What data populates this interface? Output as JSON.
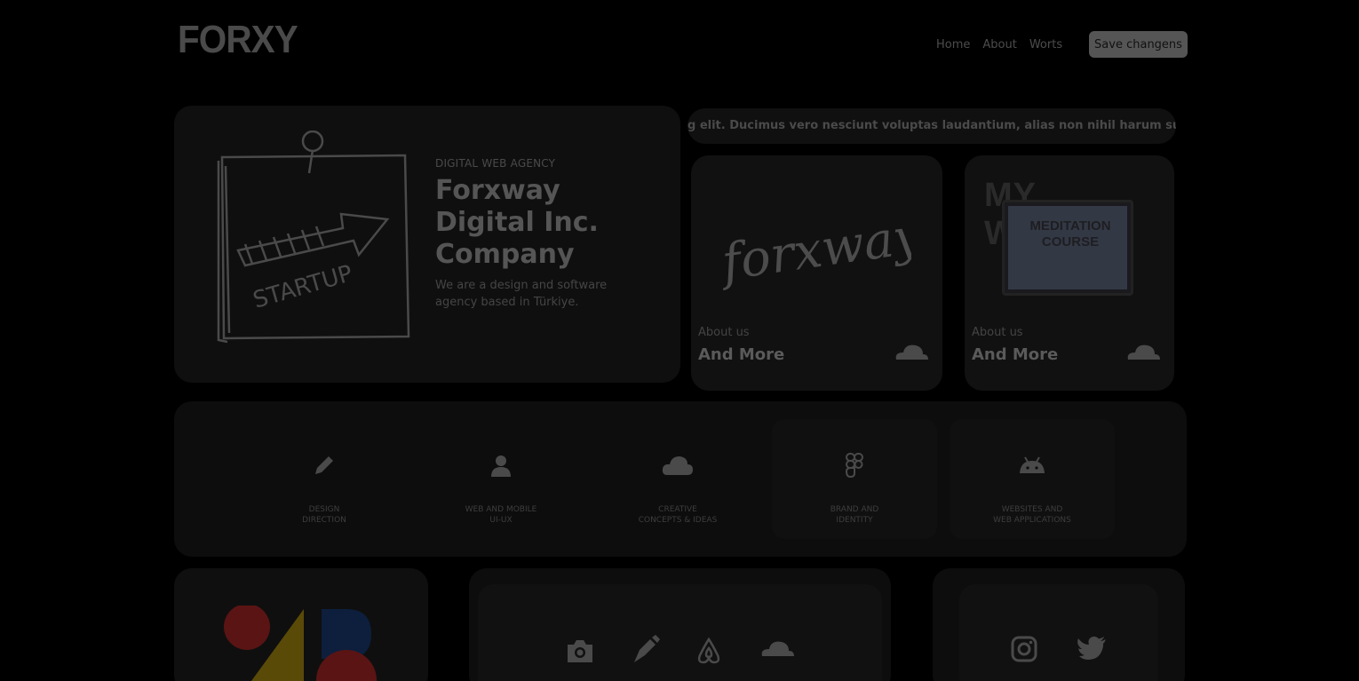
{
  "header": {
    "logo": "FORXY",
    "nav": [
      "Home",
      "About",
      "Worts"
    ],
    "save_button": "Save changens"
  },
  "hero": {
    "subtitle": "DIGITAL WEB AGENCY",
    "title": "Forxway Digital Inc. Company",
    "description": "We are a design and software agency based in Türkiye.",
    "sketch_text": "STARTUP"
  },
  "marquee": {
    "text": "g elit. Ducimus vero nesciunt voluptas laudantium, alias non nihil harum sunt voluptatum se"
  },
  "tiles": [
    {
      "signature": "forxway",
      "caption": "About us",
      "heading": "And More",
      "icon": "cloudflare-icon"
    },
    {
      "banner": "MY WORKS",
      "screen_text": "MEDITATION COURSE",
      "caption": "About us",
      "heading": "And More",
      "icon": "cloudflare-icon"
    }
  ],
  "services": [
    {
      "icon": "pencil-icon",
      "line1": "DESIGN",
      "line2": "DIRECTION"
    },
    {
      "icon": "user-icon",
      "line1": "WEB AND MOBILE",
      "line2": "UI-UX"
    },
    {
      "icon": "cloud-icon",
      "line1": "CREATIVE",
      "line2": "CONCEPTS & IDEAS"
    },
    {
      "icon": "figma-icon",
      "line1": "BRAND AND",
      "line2": "IDENTITY"
    },
    {
      "icon": "android-icon",
      "line1": "WEBSITES AND",
      "line2": "WEB APPLICATIONS"
    }
  ],
  "tools": [
    "camera-icon",
    "pen-icon",
    "airbnb-icon",
    "cloudflare-icon"
  ],
  "social": [
    "instagram-icon",
    "twitter-icon"
  ],
  "colors": {
    "background": "#000000",
    "card": "#0d0d0d",
    "text_muted": "#555555",
    "shape_red": "#5a1414",
    "shape_blue": "#0d1f3d",
    "shape_yellow": "#5a4a08"
  }
}
